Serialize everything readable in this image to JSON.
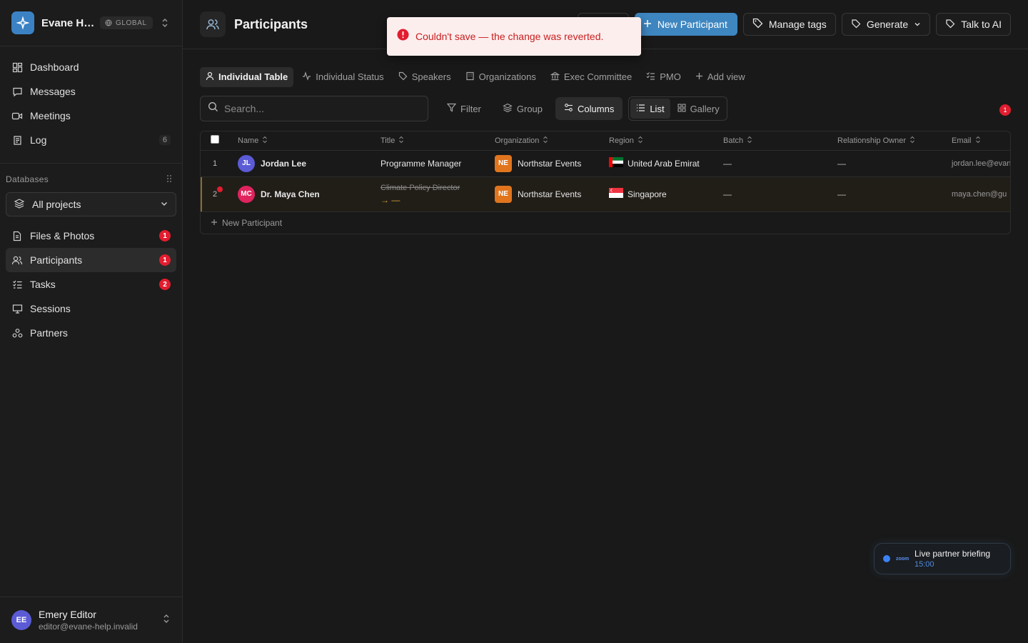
{
  "workspace": {
    "name": "Evane He...",
    "badge": "GLOBAL"
  },
  "nav": [
    {
      "label": "Dashboard",
      "icon": "dashboard-icon"
    },
    {
      "label": "Messages",
      "icon": "message-icon"
    },
    {
      "label": "Meetings",
      "icon": "video-icon"
    },
    {
      "label": "Log",
      "icon": "log-icon",
      "count": "6"
    }
  ],
  "databases": {
    "label": "Databases",
    "project_select": "All projects",
    "items": [
      {
        "label": "Files & Photos",
        "icon": "file-icon",
        "count": "1"
      },
      {
        "label": "Participants",
        "icon": "users-icon",
        "count": "1"
      },
      {
        "label": "Tasks",
        "icon": "tasks-icon",
        "count": "2"
      },
      {
        "label": "Sessions",
        "icon": "presentation-icon"
      },
      {
        "label": "Partners",
        "icon": "partners-icon"
      }
    ]
  },
  "user": {
    "initials": "EE",
    "name": "Emery Editor",
    "email": "editor@evane-help.invalid"
  },
  "page": {
    "title": "Participants"
  },
  "actions": {
    "new_participant": "New Participant",
    "manage_tags": "Manage tags",
    "generate": "Generate",
    "talk_to_ai": "Talk to AI"
  },
  "toast": {
    "message": "Couldn't save — the change was reverted."
  },
  "views": {
    "tabs": [
      "Individual Table",
      "Individual Status",
      "Speakers",
      "Organizations",
      "Exec Committee",
      "PMO"
    ],
    "add_view": "Add view"
  },
  "toolbar": {
    "search_placeholder": "Search...",
    "filter": "Filter",
    "group": "Group",
    "columns": "Columns",
    "list": "List",
    "gallery": "Gallery",
    "notification_count": "1"
  },
  "table": {
    "columns": [
      "Name",
      "Title",
      "Organization",
      "Region",
      "Batch",
      "Relationship Owner",
      "Email"
    ],
    "rows": [
      {
        "index": "1",
        "initials": "JL",
        "avatar_color": "#5b5bd6",
        "name": "Jordan Lee",
        "title": "Programme Manager",
        "org_initials": "NE",
        "organization": "Northstar Events",
        "region": "United Arab Emirat",
        "batch": "—",
        "owner": "—",
        "email": "jordan.lee@evane"
      },
      {
        "index": "2",
        "initials": "MC",
        "avatar_color": "#e0245e",
        "name": "Dr. Maya Chen",
        "title_old": "Climate Policy Director",
        "title_new": "→ —",
        "org_initials": "NE",
        "organization": "Northstar Events",
        "region": "Singapore",
        "batch": "—",
        "owner": "—",
        "email": "maya.chen@gu"
      }
    ],
    "new_row_label": "New Participant"
  },
  "live": {
    "title": "Live partner briefing",
    "time": "15:00",
    "brand": "zoom"
  },
  "colors": {
    "accent": "#3e86c0",
    "danger": "#e11d2f",
    "background": "#191919"
  }
}
